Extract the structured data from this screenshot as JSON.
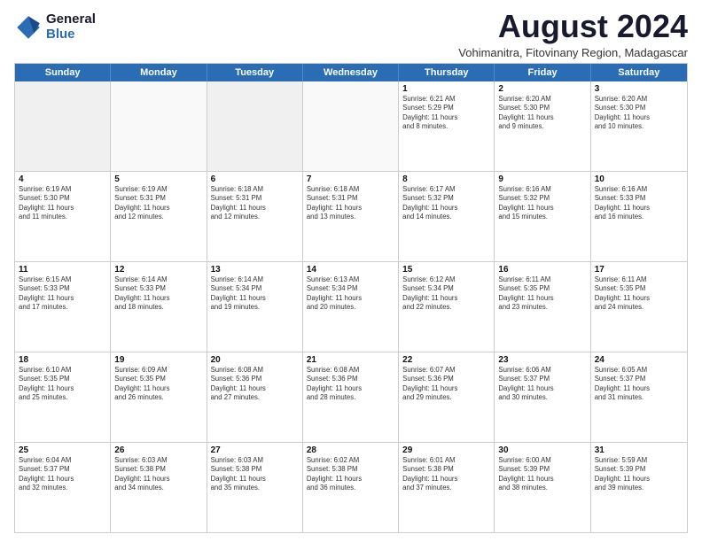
{
  "logo": {
    "general": "General",
    "blue": "Blue"
  },
  "title": {
    "month_year": "August 2024",
    "location": "Vohimanitra, Fitovinany Region, Madagascar"
  },
  "header_days": [
    "Sunday",
    "Monday",
    "Tuesday",
    "Wednesday",
    "Thursday",
    "Friday",
    "Saturday"
  ],
  "weeks": [
    [
      {
        "day": "",
        "info": "",
        "empty": true
      },
      {
        "day": "",
        "info": "",
        "empty": true
      },
      {
        "day": "",
        "info": "",
        "empty": true
      },
      {
        "day": "",
        "info": "",
        "empty": true
      },
      {
        "day": "1",
        "info": "Sunrise: 6:21 AM\nSunset: 5:29 PM\nDaylight: 11 hours\nand 8 minutes."
      },
      {
        "day": "2",
        "info": "Sunrise: 6:20 AM\nSunset: 5:30 PM\nDaylight: 11 hours\nand 9 minutes."
      },
      {
        "day": "3",
        "info": "Sunrise: 6:20 AM\nSunset: 5:30 PM\nDaylight: 11 hours\nand 10 minutes."
      }
    ],
    [
      {
        "day": "4",
        "info": "Sunrise: 6:19 AM\nSunset: 5:30 PM\nDaylight: 11 hours\nand 11 minutes."
      },
      {
        "day": "5",
        "info": "Sunrise: 6:19 AM\nSunset: 5:31 PM\nDaylight: 11 hours\nand 12 minutes."
      },
      {
        "day": "6",
        "info": "Sunrise: 6:18 AM\nSunset: 5:31 PM\nDaylight: 11 hours\nand 12 minutes."
      },
      {
        "day": "7",
        "info": "Sunrise: 6:18 AM\nSunset: 5:31 PM\nDaylight: 11 hours\nand 13 minutes."
      },
      {
        "day": "8",
        "info": "Sunrise: 6:17 AM\nSunset: 5:32 PM\nDaylight: 11 hours\nand 14 minutes."
      },
      {
        "day": "9",
        "info": "Sunrise: 6:16 AM\nSunset: 5:32 PM\nDaylight: 11 hours\nand 15 minutes."
      },
      {
        "day": "10",
        "info": "Sunrise: 6:16 AM\nSunset: 5:33 PM\nDaylight: 11 hours\nand 16 minutes."
      }
    ],
    [
      {
        "day": "11",
        "info": "Sunrise: 6:15 AM\nSunset: 5:33 PM\nDaylight: 11 hours\nand 17 minutes."
      },
      {
        "day": "12",
        "info": "Sunrise: 6:14 AM\nSunset: 5:33 PM\nDaylight: 11 hours\nand 18 minutes."
      },
      {
        "day": "13",
        "info": "Sunrise: 6:14 AM\nSunset: 5:34 PM\nDaylight: 11 hours\nand 19 minutes."
      },
      {
        "day": "14",
        "info": "Sunrise: 6:13 AM\nSunset: 5:34 PM\nDaylight: 11 hours\nand 20 minutes."
      },
      {
        "day": "15",
        "info": "Sunrise: 6:12 AM\nSunset: 5:34 PM\nDaylight: 11 hours\nand 22 minutes."
      },
      {
        "day": "16",
        "info": "Sunrise: 6:11 AM\nSunset: 5:35 PM\nDaylight: 11 hours\nand 23 minutes."
      },
      {
        "day": "17",
        "info": "Sunrise: 6:11 AM\nSunset: 5:35 PM\nDaylight: 11 hours\nand 24 minutes."
      }
    ],
    [
      {
        "day": "18",
        "info": "Sunrise: 6:10 AM\nSunset: 5:35 PM\nDaylight: 11 hours\nand 25 minutes."
      },
      {
        "day": "19",
        "info": "Sunrise: 6:09 AM\nSunset: 5:35 PM\nDaylight: 11 hours\nand 26 minutes."
      },
      {
        "day": "20",
        "info": "Sunrise: 6:08 AM\nSunset: 5:36 PM\nDaylight: 11 hours\nand 27 minutes."
      },
      {
        "day": "21",
        "info": "Sunrise: 6:08 AM\nSunset: 5:36 PM\nDaylight: 11 hours\nand 28 minutes."
      },
      {
        "day": "22",
        "info": "Sunrise: 6:07 AM\nSunset: 5:36 PM\nDaylight: 11 hours\nand 29 minutes."
      },
      {
        "day": "23",
        "info": "Sunrise: 6:06 AM\nSunset: 5:37 PM\nDaylight: 11 hours\nand 30 minutes."
      },
      {
        "day": "24",
        "info": "Sunrise: 6:05 AM\nSunset: 5:37 PM\nDaylight: 11 hours\nand 31 minutes."
      }
    ],
    [
      {
        "day": "25",
        "info": "Sunrise: 6:04 AM\nSunset: 5:37 PM\nDaylight: 11 hours\nand 32 minutes."
      },
      {
        "day": "26",
        "info": "Sunrise: 6:03 AM\nSunset: 5:38 PM\nDaylight: 11 hours\nand 34 minutes."
      },
      {
        "day": "27",
        "info": "Sunrise: 6:03 AM\nSunset: 5:38 PM\nDaylight: 11 hours\nand 35 minutes."
      },
      {
        "day": "28",
        "info": "Sunrise: 6:02 AM\nSunset: 5:38 PM\nDaylight: 11 hours\nand 36 minutes."
      },
      {
        "day": "29",
        "info": "Sunrise: 6:01 AM\nSunset: 5:38 PM\nDaylight: 11 hours\nand 37 minutes."
      },
      {
        "day": "30",
        "info": "Sunrise: 6:00 AM\nSunset: 5:39 PM\nDaylight: 11 hours\nand 38 minutes."
      },
      {
        "day": "31",
        "info": "Sunrise: 5:59 AM\nSunset: 5:39 PM\nDaylight: 11 hours\nand 39 minutes."
      }
    ]
  ]
}
